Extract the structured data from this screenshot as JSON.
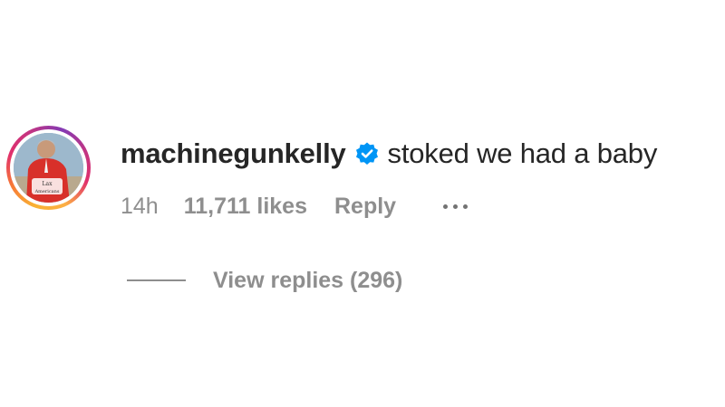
{
  "comment": {
    "username": "machinegunkelly",
    "verified": true,
    "text": "stoked we had a baby",
    "timestamp": "14h",
    "likes": "11,711 likes",
    "reply_label": "Reply",
    "view_replies_label": "View replies (296)"
  },
  "avatar": {
    "jersey_text_line1": "Lax",
    "jersey_text_line2": "Americans"
  },
  "icons": {
    "verified": "verified-badge-icon",
    "more": "more-options-icon"
  },
  "colors": {
    "text_primary": "#262626",
    "text_secondary": "#8e8e8e",
    "verified_blue": "#0095f6"
  }
}
